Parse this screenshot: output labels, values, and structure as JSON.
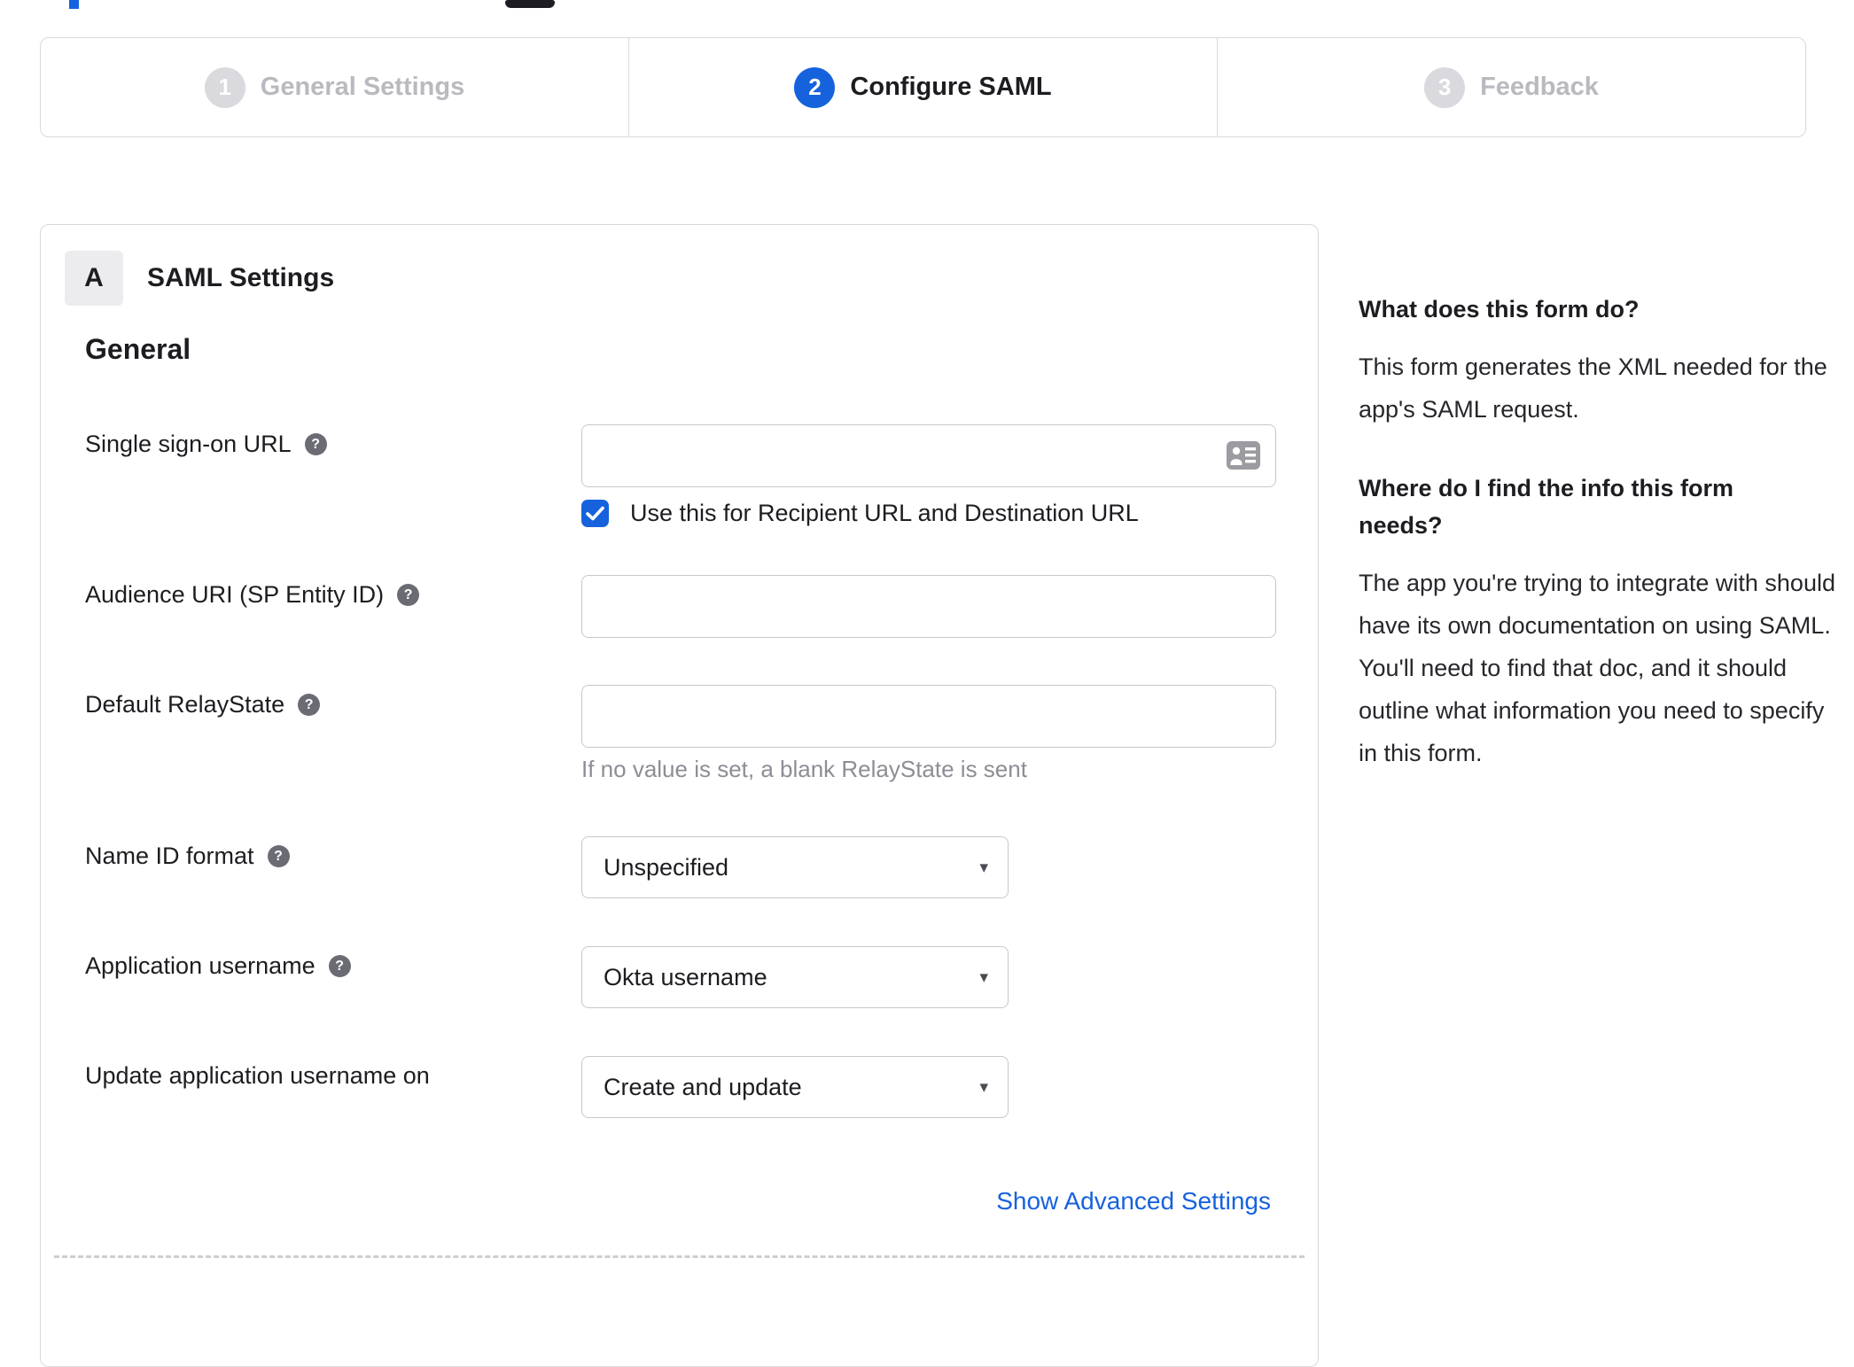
{
  "colors": {
    "accent_blue": "#1662dd",
    "text_dark": "#1d1d21",
    "muted_gray": "#8d8d95",
    "inactive_step_gray": "#b9b9bf",
    "border_gray": "#c8c8cc"
  },
  "stepper": {
    "active_step": "Configure SAML",
    "steps": [
      {
        "number": "1",
        "label": "General Settings"
      },
      {
        "number": "2",
        "label": "Configure SAML"
      },
      {
        "number": "3",
        "label": "Feedback"
      }
    ]
  },
  "form": {
    "section_badge": "A",
    "section_title": "SAML Settings",
    "group_heading": "General",
    "help_icon_glyph": "?",
    "dropdown_caret_glyph": "▾",
    "sso": {
      "label": "Single sign-on URL",
      "value": "",
      "checkbox_label": "Use this for Recipient URL and Destination URL",
      "checkbox_checked": true
    },
    "audience": {
      "label": "Audience URI (SP Entity ID)",
      "value": ""
    },
    "relay_state": {
      "label": "Default RelayState",
      "value": "",
      "hint": "If no value is set, a blank RelayState is sent"
    },
    "name_id_format": {
      "label": "Name ID format",
      "value": "Unspecified"
    },
    "app_username": {
      "label": "Application username",
      "value": "Okta username"
    },
    "update_username": {
      "label": "Update application username on",
      "value": "Create and update"
    },
    "advanced_link": "Show Advanced Settings"
  },
  "sidebar": {
    "sections": [
      {
        "heading": "What does this form do?",
        "body": "This form generates the XML needed for the app's SAML request."
      },
      {
        "heading": "Where do I find the info this form needs?",
        "body": "The app you're trying to integrate with should have its own documentation on using SAML. You'll need to find that doc, and it should outline what information you need to specify in this form."
      }
    ]
  }
}
